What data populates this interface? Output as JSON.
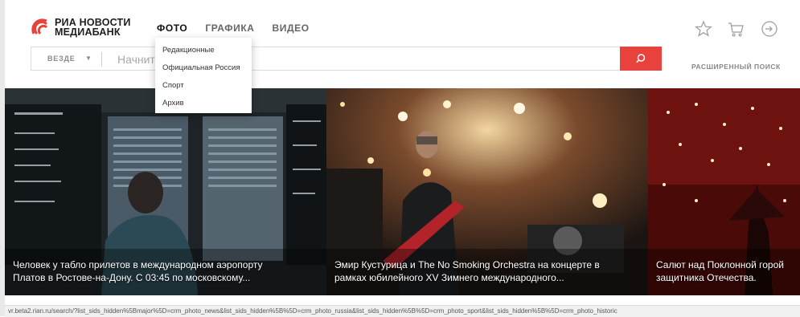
{
  "brand": {
    "line1": "РИА НОВОСТИ",
    "line2": "МЕДИАБАНК",
    "color": "#e8423c"
  },
  "nav": [
    {
      "label": "ФОТО",
      "active": true
    },
    {
      "label": "ГРАФИКА",
      "active": false
    },
    {
      "label": "ВИДЕО",
      "active": false
    }
  ],
  "header_icons": [
    "star-icon",
    "cart-icon",
    "login-icon"
  ],
  "search": {
    "scope": "ВЕЗДЕ",
    "placeholder": "Начните поиск",
    "advanced": "РАСШИРЕННЫЙ ПОИСК",
    "icon": "search-icon"
  },
  "dropdown": {
    "items": [
      "Редакционные",
      "Официальная Россия",
      "Спорт",
      "Архив"
    ]
  },
  "gallery": [
    {
      "line1": "Человек у табло прилетов в международном аэропорту",
      "line2": "Платов в Ростове-на-Дону. С 03:45 по московскому..."
    },
    {
      "line1": "Эмир Кустурица и The No Smoking Orchestra на концерте в",
      "line2": "рамках юбилейного XV Зимнего международного..."
    },
    {
      "line1": "Салют над Поклонной горой",
      "line2": "защитника Отечества."
    }
  ],
  "status_url": "vr.beta2.rian.ru/search/?list_sids_hidden%5Bmajor%5D=crm_photo_news&list_sids_hidden%5B%5D=crm_photo_russia&list_sids_hidden%5B%5D=crm_photo_sport&list_sids_hidden%5B%5D=crm_photo_historic"
}
